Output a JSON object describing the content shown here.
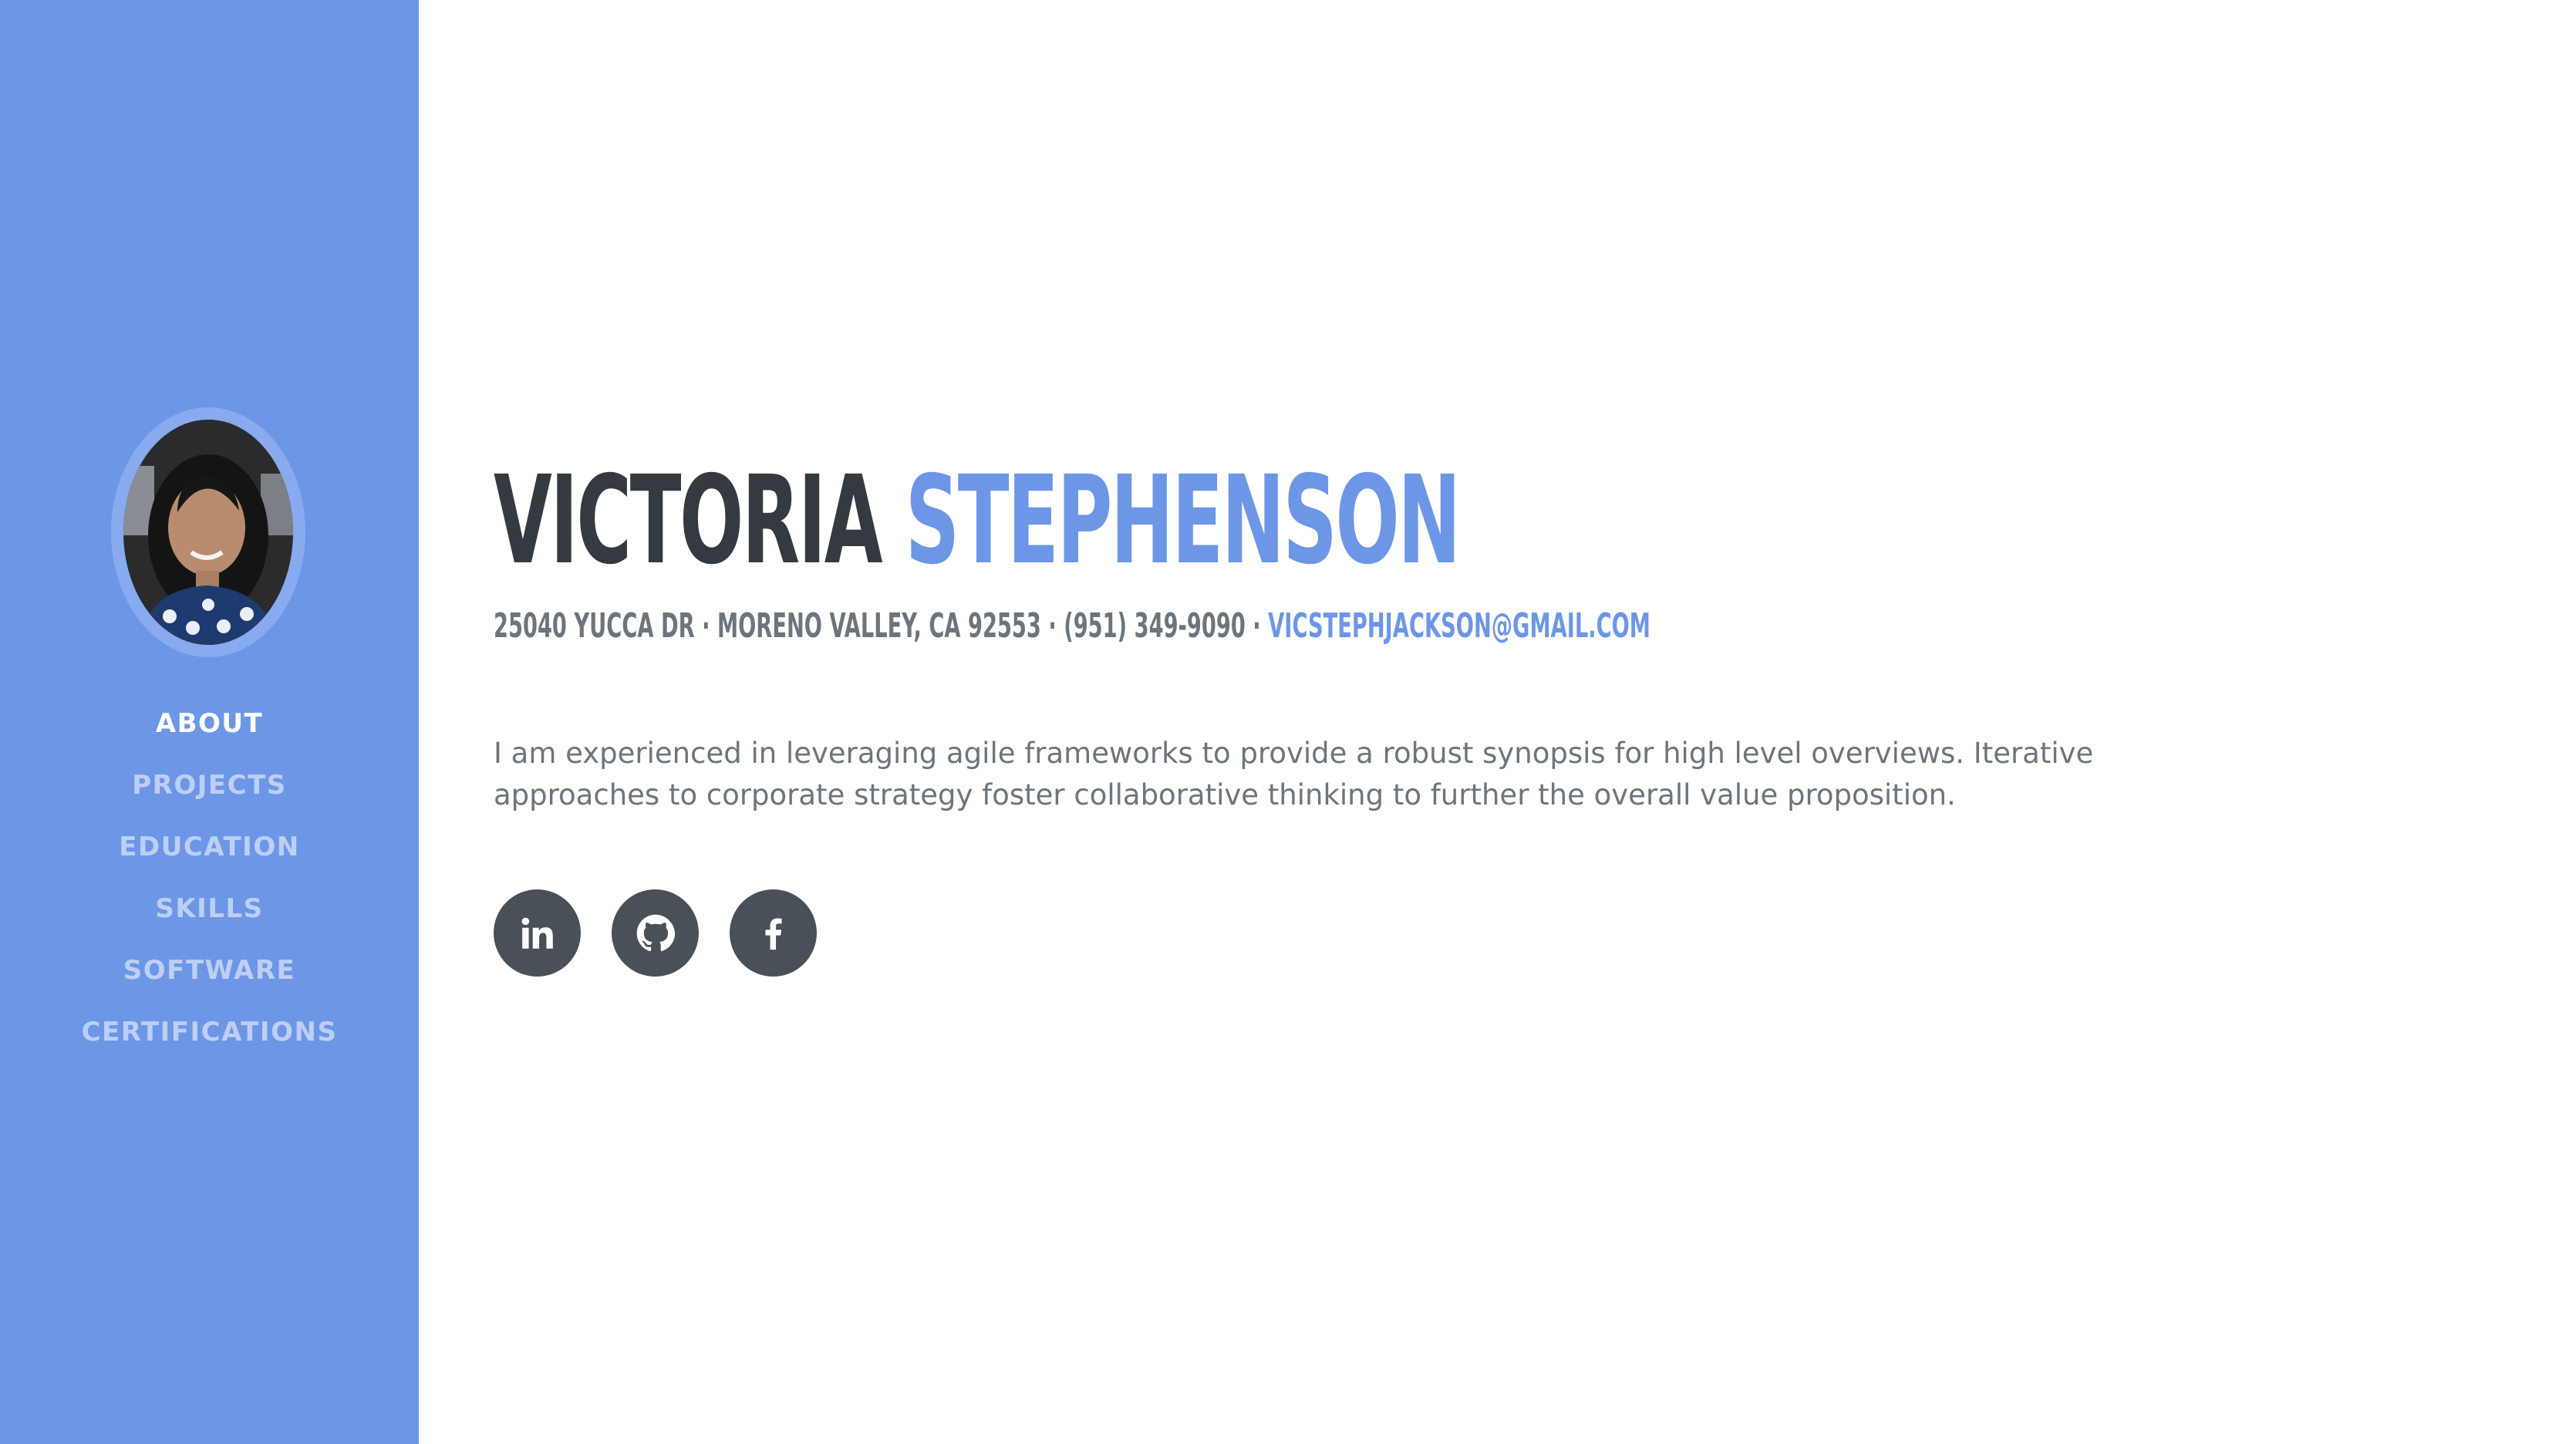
{
  "sidebar": {
    "avatar_alt": "Profile photo",
    "nav": [
      {
        "label": "ABOUT",
        "active": true
      },
      {
        "label": "PROJECTS",
        "active": false
      },
      {
        "label": "EDUCATION",
        "active": false
      },
      {
        "label": "SKILLS",
        "active": false
      },
      {
        "label": "SOFTWARE",
        "active": false
      },
      {
        "label": "CERTIFICATIONS",
        "active": false
      }
    ]
  },
  "about": {
    "first_name": "VICTORIA",
    "last_name": "STEPHENSON",
    "address": "25040 YUCCA DR · MORENO VALLEY, CA 92553 · (951) 349-9090 ·",
    "email": "VICSTEPHJACKSON@GMAIL.COM",
    "bio": "I am experienced in leveraging agile frameworks to provide a robust synopsis for high level overviews. Iterative approaches to corporate strategy foster collaborative thinking to further the overall value proposition.",
    "socials": [
      {
        "icon": "linkedin-icon"
      },
      {
        "icon": "github-icon"
      },
      {
        "icon": "facebook-icon"
      }
    ]
  },
  "colors": {
    "primary": "#6d96e6",
    "heading": "#343a40",
    "text": "#6c757d",
    "social_bg": "#495057"
  }
}
